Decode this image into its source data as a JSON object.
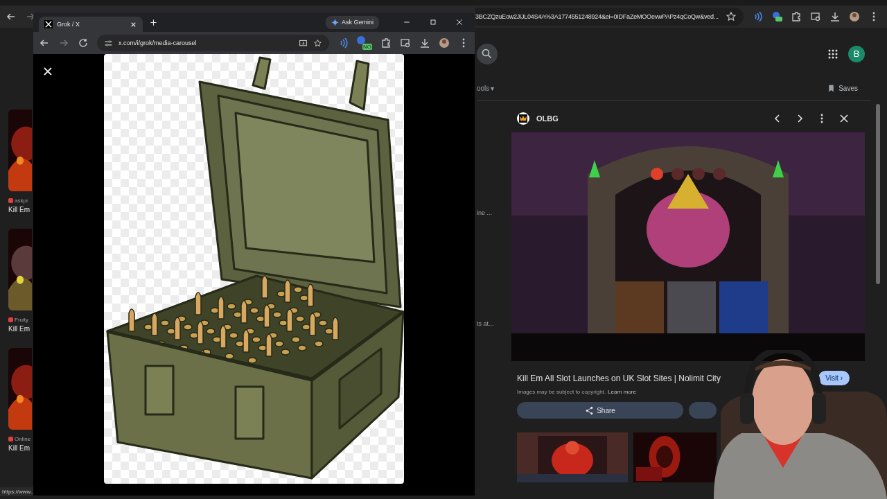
{
  "back_browser": {
    "address": "3BCZQzuEow2JiJL04S4A%3A1774551248924&ei=0IDFaZeMOOevwPAPz4qCoQw&ved...",
    "account_initial": "B",
    "tools_label": "ools",
    "tools_caret": "▾",
    "saves_label": "Saves",
    "status_url": "https://www..."
  },
  "results": [
    {
      "source": "askpr",
      "title": "Kill Em"
    },
    {
      "source": "Fruity",
      "title": "Kill Em"
    },
    {
      "source": "Online",
      "title": "Kill Em"
    }
  ],
  "snippets": [
    "ine ...",
    "ts at..."
  ],
  "image_panel": {
    "source": "OLBG",
    "title": "Kill Em All Slot Launches on UK Slot Sites | Nolimit City",
    "copyright": "Images may be subject to copyright.",
    "learn_more": "Learn more",
    "visit": "Visit ›",
    "share": "Share"
  },
  "front_window": {
    "tab_title": "Grok / X",
    "ask_button": "Ask Gemini",
    "address": "x.com/i/grok/media-carousel",
    "extension_badge": "NO"
  }
}
